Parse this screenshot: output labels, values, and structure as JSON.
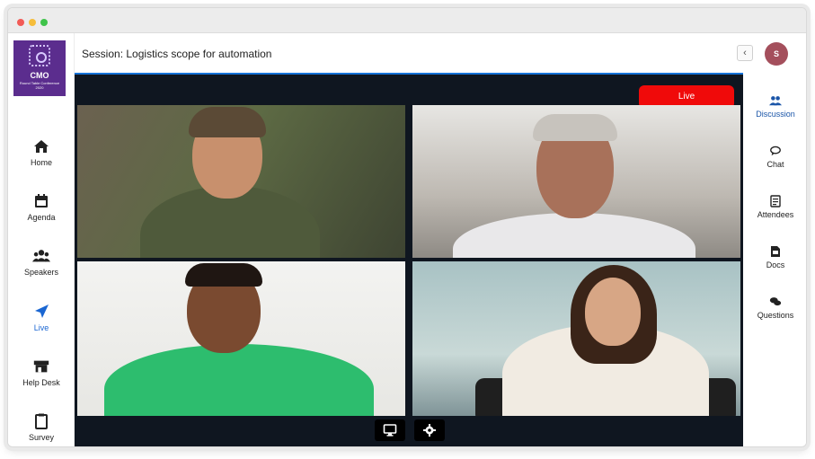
{
  "window": {
    "controls": [
      "close",
      "minimize",
      "maximize"
    ]
  },
  "logo": {
    "title": "CMO",
    "subtitle": "Round Table Conference 2020"
  },
  "left_nav": [
    {
      "label": "Home",
      "icon": "home-icon"
    },
    {
      "label": "Agenda",
      "icon": "calendar-icon"
    },
    {
      "label": "Speakers",
      "icon": "users-icon"
    },
    {
      "label": "Live",
      "icon": "paper-plane-icon",
      "active": true
    },
    {
      "label": "Help Desk",
      "icon": "store-icon"
    },
    {
      "label": "Survey",
      "icon": "clipboard-icon"
    }
  ],
  "header": {
    "session_label": "Session:",
    "session_title": "Logistics scope for automation",
    "collapse": "‹",
    "avatar_initial": "S"
  },
  "stage": {
    "live_label": "Live"
  },
  "controls": {
    "screen_share": "monitor-icon",
    "settings": "gear-icon"
  },
  "right_nav": [
    {
      "label": "Discussion",
      "icon": "users-icon",
      "active": true
    },
    {
      "label": "Chat",
      "icon": "chat-icon"
    },
    {
      "label": "Attendees",
      "icon": "list-icon"
    },
    {
      "label": "Docs",
      "icon": "pdf-icon"
    },
    {
      "label": "Questions",
      "icon": "comments-icon"
    }
  ],
  "colors": {
    "brand": "#5b2d8e",
    "accent": "#1a66d2",
    "live": "#f00a0a",
    "stage": "#0f1620"
  }
}
